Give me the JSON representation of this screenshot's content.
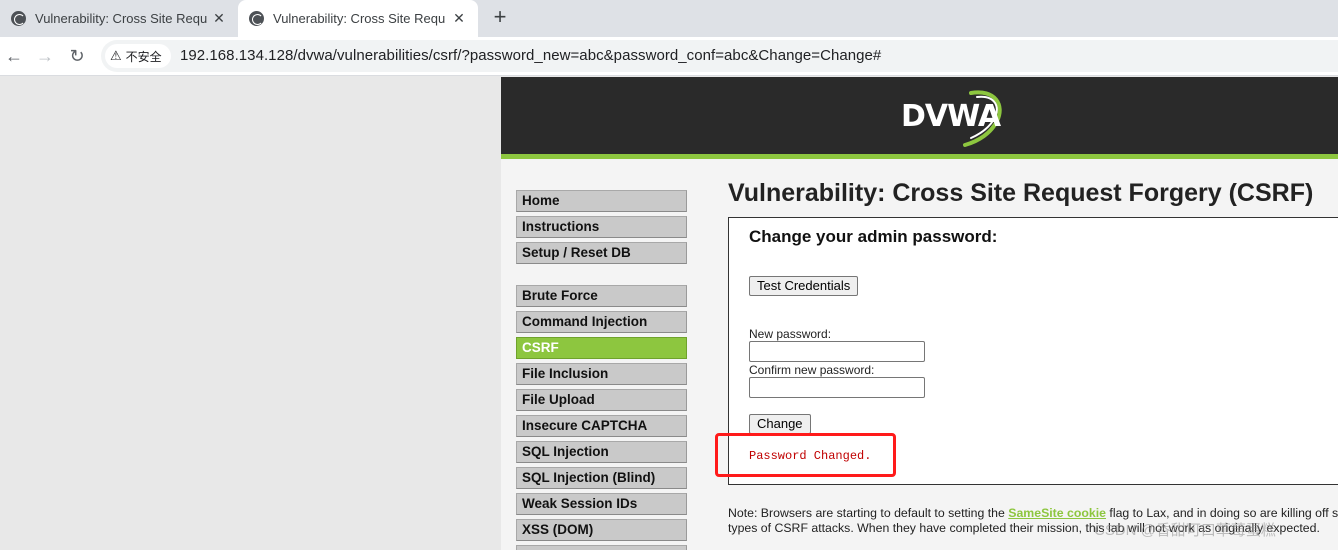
{
  "browser": {
    "tabs": [
      {
        "title": "Vulnerability: Cross Site Request Forgery (CSRF) :: Damn Vulnerable Web Application (DVWA)",
        "active": false
      },
      {
        "title": "Vulnerability: Cross Site Request Forgery (CSRF) :: Damn Vulnerable Web Application (DVWA)",
        "active": true
      }
    ],
    "close_glyph": "✕",
    "new_tab_glyph": "+",
    "security_label": "不安全",
    "url": "192.168.134.128/dvwa/vulnerabilities/csrf/?password_new=abc&password_conf=abc&Change=Change#"
  },
  "header": {
    "logo_text": "DVWA",
    "accent_color": "#8dc63f"
  },
  "menu": {
    "items": [
      {
        "label": "Home",
        "active": false
      },
      {
        "label": "Instructions",
        "active": false
      },
      {
        "label": "Setup / Reset DB",
        "active": false
      },
      {
        "label": "Brute Force",
        "active": false
      },
      {
        "label": "Command Injection",
        "active": false
      },
      {
        "label": "CSRF",
        "active": true
      },
      {
        "label": "File Inclusion",
        "active": false
      },
      {
        "label": "File Upload",
        "active": false
      },
      {
        "label": "Insecure CAPTCHA",
        "active": false
      },
      {
        "label": "SQL Injection",
        "active": false
      },
      {
        "label": "SQL Injection (Blind)",
        "active": false
      },
      {
        "label": "Weak Session IDs",
        "active": false
      },
      {
        "label": "XSS (DOM)",
        "active": false
      }
    ]
  },
  "main": {
    "title": "Vulnerability: Cross Site Request Forgery (CSRF)",
    "form_heading": "Change your admin password:",
    "test_button": "Test Credentials",
    "new_password_label": "New password:",
    "confirm_password_label": "Confirm new password:",
    "change_button": "Change",
    "result_message": "Password Changed.",
    "result_color": "#c00000",
    "note_prefix": "Note: Browsers are starting to default to setting the ",
    "note_link": "SameSite cookie",
    "note_suffix": " flag to Lax, and in doing so are killing off some types of CSRF attacks. When they have completed their mission, this lab will not work as originally expected."
  },
  "watermark": "CSDN @香甜可口草莓蛋糕"
}
